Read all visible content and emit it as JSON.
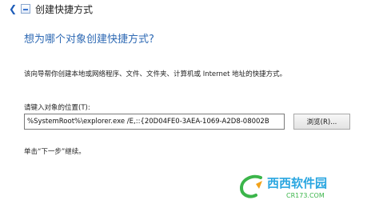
{
  "window": {
    "title": "创建快捷方式"
  },
  "main": {
    "heading": "想为哪个对象创建快捷方式?",
    "description": "该向导帮你创建本地或网络程序、文件、文件夹、计算机或 Internet 地址的快捷方式。",
    "location_label": "请键入对象的位置(T):",
    "location_value": "%SystemRoot%\\explorer.exe /E,::{20D04FE0-3AEA-1069-A2D8-08002B",
    "browse_label": "浏览(R)...",
    "continue_hint": "单击“下一步”继续。"
  },
  "watermark": {
    "text": "西西软件园",
    "subtext": "CR173.COM"
  },
  "colors": {
    "heading": "#2f6ab4",
    "watermark_blue": "#2aa6e0",
    "watermark_green": "#3bb54a"
  },
  "icons": {
    "back": "back-arrow-icon",
    "wizard": "shortcut-wizard-icon",
    "watermark": "xixi-logo-icon"
  }
}
